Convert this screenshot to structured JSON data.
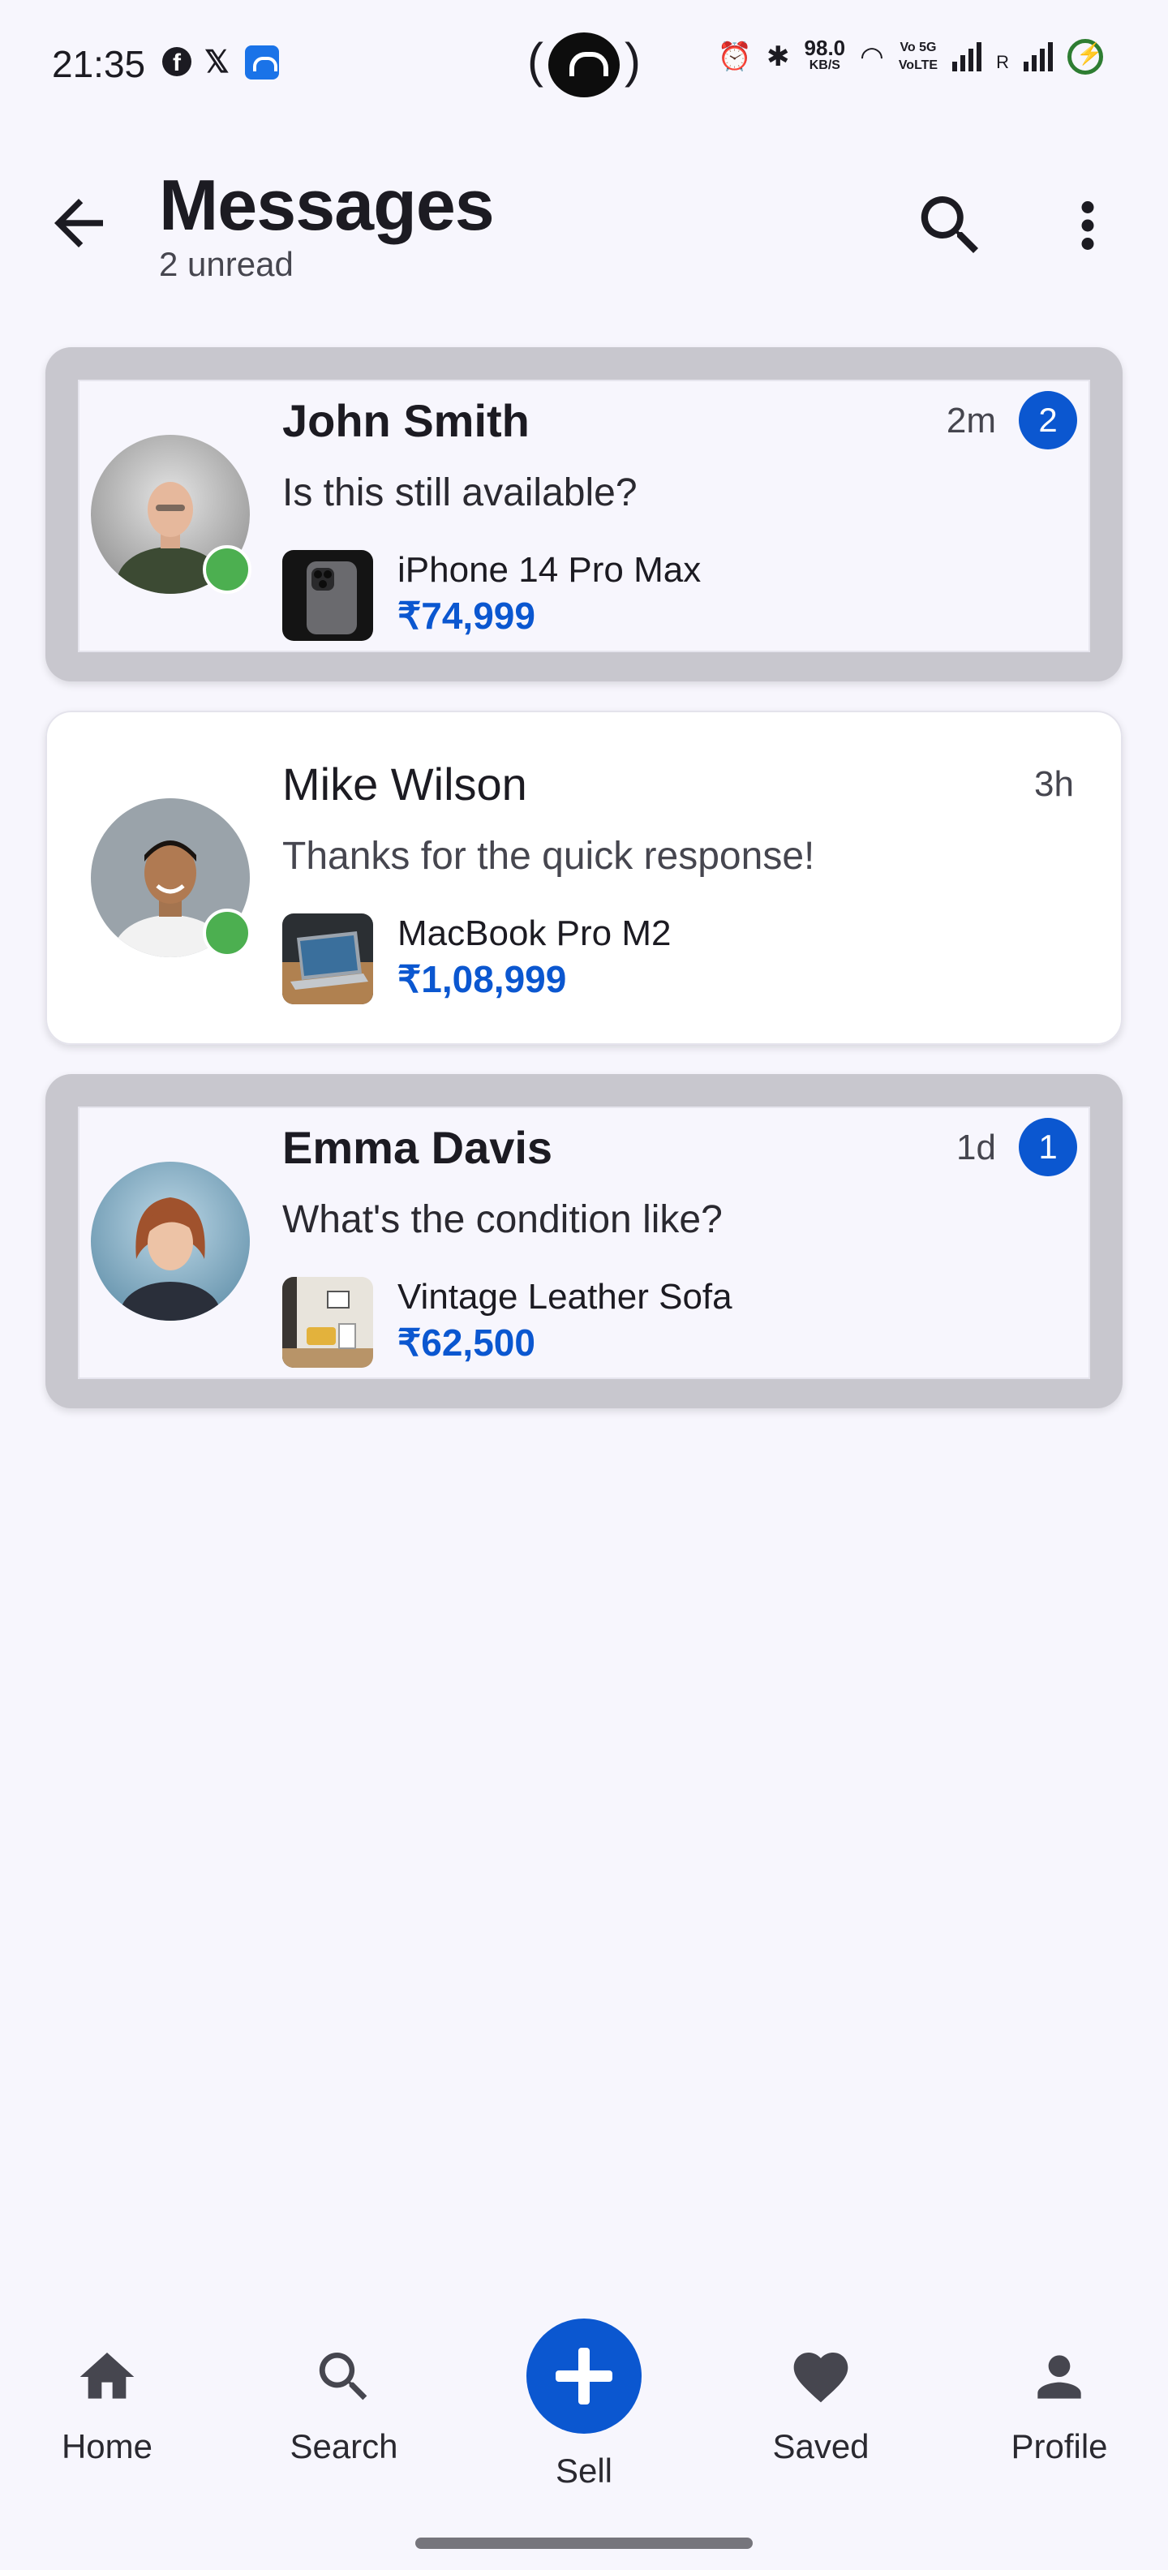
{
  "status_bar": {
    "time": "21:35",
    "speed_value": "98.0",
    "speed_unit": "KB/S",
    "volte_1": "Vo 5G",
    "volte_2": "VoLTE",
    "roaming": "R"
  },
  "header": {
    "title": "Messages",
    "subtitle": "2 unread"
  },
  "conversations": [
    {
      "name": "John Smith",
      "time": "2m",
      "unread_count": "2",
      "message": "Is this still available?",
      "product_name": "iPhone 14 Pro Max",
      "product_price": "₹74,999",
      "online": true,
      "unread": true
    },
    {
      "name": "Mike Wilson",
      "time": "3h",
      "message": "Thanks for the quick response!",
      "product_name": "MacBook Pro M2",
      "product_price": "₹1,08,999",
      "online": true,
      "unread": false
    },
    {
      "name": "Emma Davis",
      "time": "1d",
      "unread_count": "1",
      "message": "What's the condition like?",
      "product_name": "Vintage Leather Sofa",
      "product_price": "₹62,500",
      "online": false,
      "unread": true
    }
  ],
  "bottom_nav": {
    "home": "Home",
    "search": "Search",
    "sell": "Sell",
    "saved": "Saved",
    "profile": "Profile"
  },
  "colors": {
    "accent": "#0b57d0",
    "online": "#4caf50",
    "background": "#f7f6fd"
  }
}
